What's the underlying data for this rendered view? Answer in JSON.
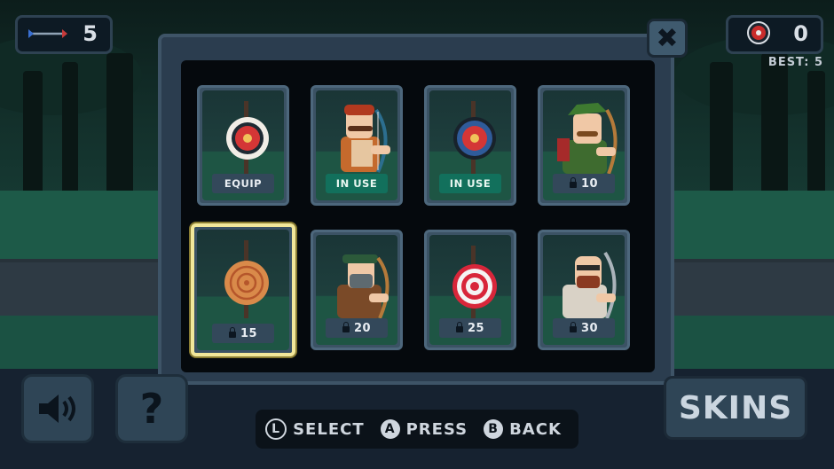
{
  "hud": {
    "arrows_count": "5",
    "score": "0",
    "best_label": "BEST: 5"
  },
  "panel": {
    "close_icon": "close-x-icon",
    "skins": [
      {
        "kind": "target",
        "style": "white-ring",
        "status": "EQUIP"
      },
      {
        "kind": "archer",
        "style": "red-hair-mustache",
        "status": "IN USE"
      },
      {
        "kind": "target",
        "style": "dark-ring",
        "status": "IN USE"
      },
      {
        "kind": "archer",
        "style": "robin-hood",
        "status": "10"
      },
      {
        "kind": "target",
        "style": "wooden",
        "status": "15"
      },
      {
        "kind": "archer",
        "style": "green-hat-beard",
        "status": "20"
      },
      {
        "kind": "target",
        "style": "red-white-rings",
        "status": "25"
      },
      {
        "kind": "archer",
        "style": "bald-glasses",
        "status": "30"
      }
    ]
  },
  "buttons": {
    "skins_label": "SKINS",
    "help_label": "?",
    "sound_icon": "speaker-icon"
  },
  "controls": {
    "l_key": "L",
    "select_label": "SELECT",
    "a_key": "A",
    "press_label": "PRESS",
    "b_key": "B",
    "back_label": "BACK"
  },
  "colors": {
    "in_use": "#12705c",
    "selected_border": "#f2e79a",
    "panel": "#2b3d4f"
  }
}
